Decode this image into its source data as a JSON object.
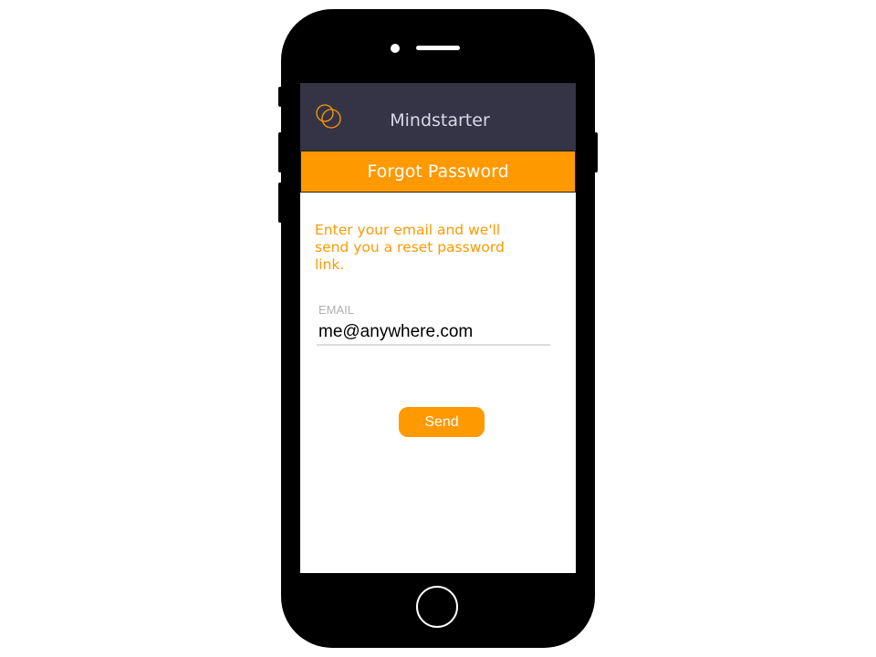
{
  "app": {
    "title": "Mindstarter",
    "logo_icon": "interlocking-circles-icon",
    "accent": "#ff9900",
    "header_bg": "#353446"
  },
  "page": {
    "title": "Forgot Password",
    "message": "Enter your email and we'll send you a reset password link."
  },
  "form": {
    "email_label": "EMAIL",
    "email_value": "me@anywhere.com",
    "send_label": "Send"
  }
}
